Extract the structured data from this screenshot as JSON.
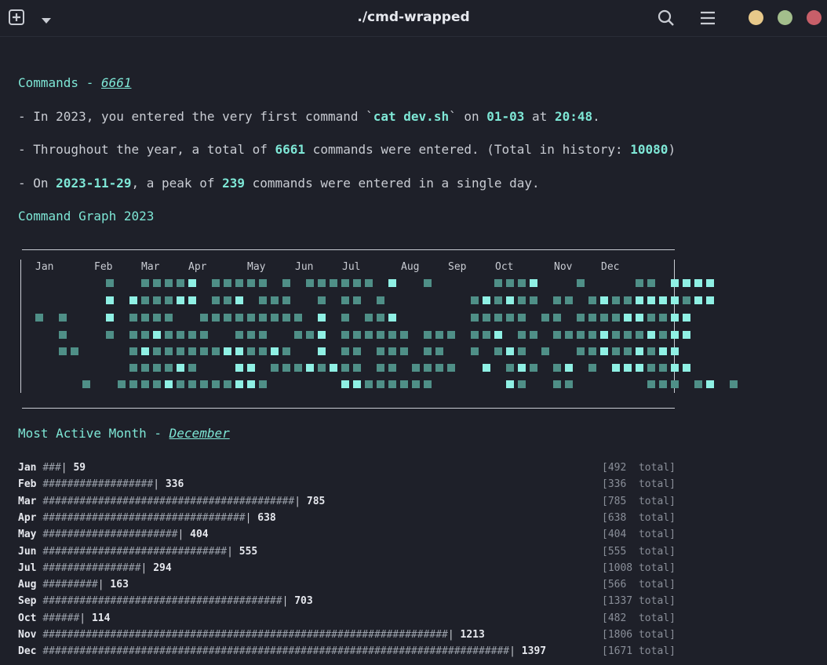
{
  "window": {
    "title": "./cmd-wrapped"
  },
  "colors": {
    "accent": "#7ee7d6",
    "dim_square": "#4f8f87",
    "bright_square": "#8ff0e4",
    "close": "#c85f69",
    "minimize": "#e8c98a",
    "maximize": "#a3be8c"
  },
  "commands": {
    "heading_prefix": "Commands - ",
    "heading_value": "6661",
    "first_line": {
      "p1": "- In 2023, you entered the very first command `",
      "cmd": "cat dev.sh",
      "p2": "` on ",
      "date": "01-03",
      "p3": " at ",
      "time": "20:48",
      "p4": "."
    },
    "total_line": {
      "p1": "- Throughout the year, a total of ",
      "total": "6661",
      "p2": " commands were entered. (Total in history: ",
      "history": "10080",
      "p3": ")"
    },
    "peak_line": {
      "p1": "- On ",
      "date": "2023-11-29",
      "p2": ", a peak of ",
      "peak": "239",
      "p3": " commands were entered in a single day."
    }
  },
  "graph": {
    "heading": "Command Graph 2023",
    "months": [
      "Jan",
      "Feb",
      "Mar",
      "Apr",
      "May",
      "Jun",
      "Jul",
      "Aug",
      "Sep",
      "Oct",
      "Nov",
      "Dec"
    ]
  },
  "most_active": {
    "heading_prefix": "Most Active Month - ",
    "heading_value": "December",
    "rows": [
      {
        "month": "Jan",
        "hashes": "###",
        "value": "59",
        "total": "[492  total]"
      },
      {
        "month": "Feb",
        "hashes": "##################",
        "value": "336",
        "total": "[336  total]"
      },
      {
        "month": "Mar",
        "hashes": "#########################################",
        "value": "785",
        "total": "[785  total]"
      },
      {
        "month": "Apr",
        "hashes": "#################################",
        "value": "638",
        "total": "[638  total]"
      },
      {
        "month": "May",
        "hashes": "######################",
        "value": "404",
        "total": "[404  total]"
      },
      {
        "month": "Jun",
        "hashes": "##############################",
        "value": "555",
        "total": "[555  total]"
      },
      {
        "month": "Jul",
        "hashes": "################",
        "value": "294",
        "total": "[1008 total]"
      },
      {
        "month": "Aug",
        "hashes": "#########",
        "value": "163",
        "total": "[566  total]"
      },
      {
        "month": "Sep",
        "hashes": "#######################################",
        "value": "703",
        "total": "[1337 total]"
      },
      {
        "month": "Oct",
        "hashes": "######",
        "value": "114",
        "total": "[482  total]"
      },
      {
        "month": "Nov",
        "hashes": "##################################################################",
        "value": "1213",
        "total": "[1806 total]"
      },
      {
        "month": "Dec",
        "hashes": "############################################################################",
        "value": "1397",
        "total": "[1671 total]"
      }
    ]
  }
}
